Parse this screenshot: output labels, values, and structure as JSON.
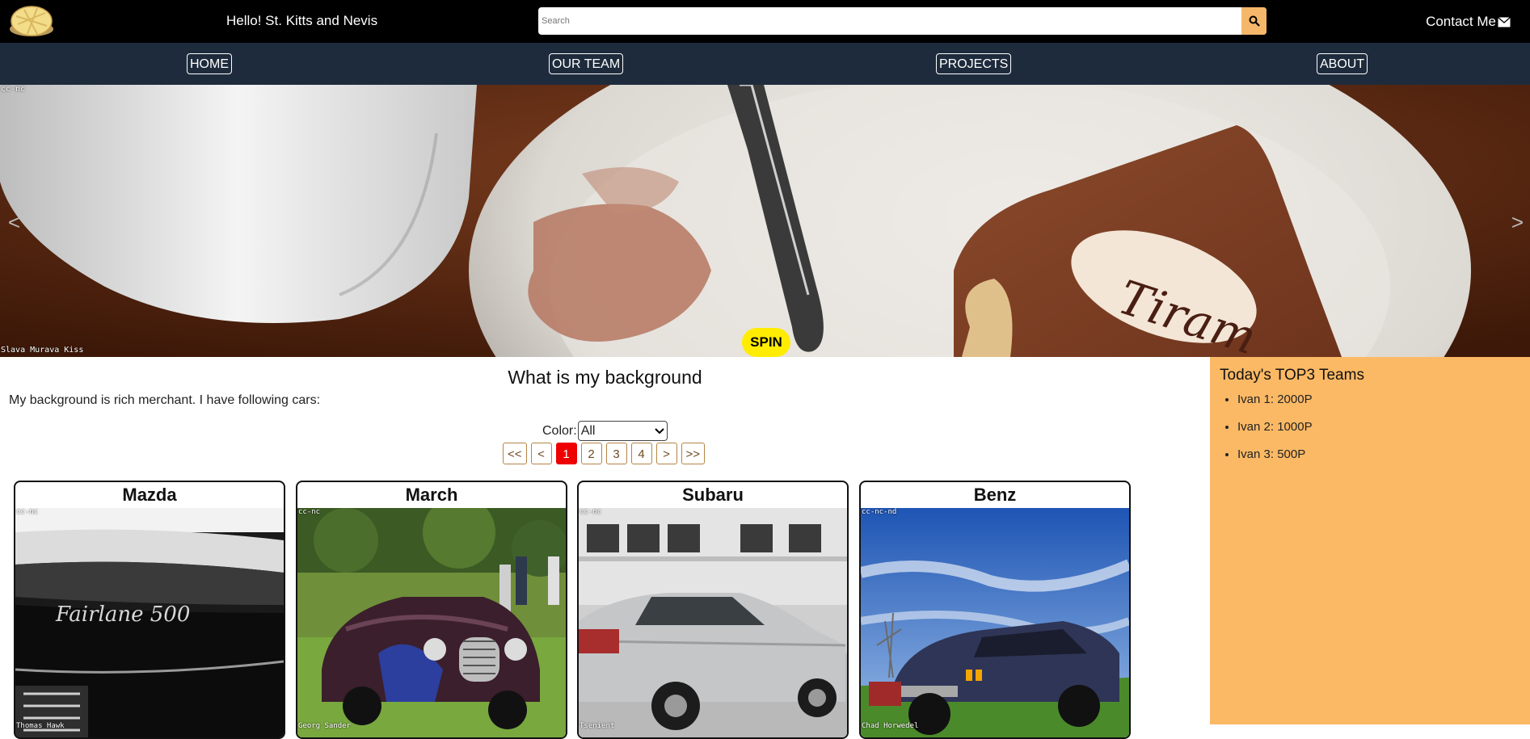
{
  "header": {
    "greeting": "Hello! St. Kitts and Nevis",
    "search_placeholder": "Search",
    "contact_label": "Contact Me"
  },
  "nav": {
    "items": [
      {
        "label": "HOME"
      },
      {
        "label": "OUR TEAM"
      },
      {
        "label": "PROJECTS"
      },
      {
        "label": "ABOUT"
      }
    ]
  },
  "hero": {
    "license": "cc-nc",
    "author": "Slava Murava Kiss",
    "prev_label": "<",
    "next_label": ">",
    "spin_label": "SPIN",
    "plate_text": "Tiram"
  },
  "main": {
    "title": "What is my background",
    "intro": "My background is rich merchant. I have following cars:",
    "color_label": "Color:",
    "color_selected": "All",
    "pager": [
      "<<",
      "<",
      "1",
      "2",
      "3",
      "4",
      ">",
      ">>"
    ],
    "pager_active": "1"
  },
  "cars": [
    {
      "name": "Mazda",
      "license": "cc-nc",
      "author": "Thomas Hawk",
      "badge": "Fairlane 500"
    },
    {
      "name": "March",
      "license": "cc-nc",
      "author": "Georg Sander"
    },
    {
      "name": "Subaru",
      "license": "cc-nc",
      "author": "Tsenient"
    },
    {
      "name": "Benz",
      "license": "cc-nc-nd",
      "author": "Chad Horwedel"
    }
  ],
  "sidebar": {
    "title": "Today's TOP3 Teams",
    "teams": [
      {
        "label": "Ivan 1: 2000P"
      },
      {
        "label": "Ivan 2: 1000P"
      },
      {
        "label": "Ivan 3: 500P"
      }
    ]
  },
  "colors": {
    "topbar": "#000000",
    "navbar": "#1e2b3c",
    "accent": "#f6b76a",
    "sidebar": "#fbb965",
    "spin": "#ffec00",
    "pager_active": "#ee0000"
  }
}
